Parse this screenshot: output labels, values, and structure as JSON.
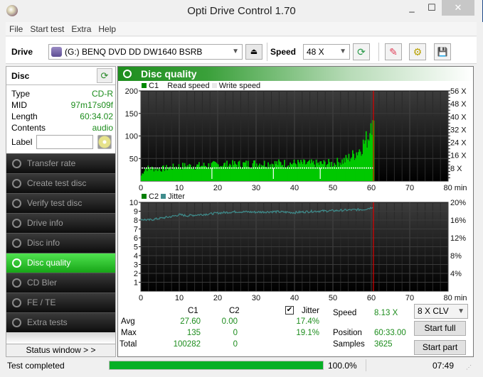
{
  "window": {
    "title": "Opti Drive Control 1.70",
    "min_label": "_",
    "max_label": "☐",
    "close_label": "✕"
  },
  "menu": [
    "File",
    "Start test",
    "Extra",
    "Help"
  ],
  "toolbar": {
    "drive_label": "Drive",
    "drive_value": "(G:)  BENQ DVD DD DW1640 BSRB",
    "eject_icon": "⏏",
    "speed_label": "Speed",
    "speed_value": "48 X",
    "refresh_icon": "⟳",
    "erase_icon": "✎",
    "settings_icon": "⚙",
    "save_icon": "💾"
  },
  "disc": {
    "title": "Disc",
    "refresh_icon": "⟳",
    "rows": [
      {
        "key": "Type",
        "value": "CD-R"
      },
      {
        "key": "MID",
        "value": "97m17s09f"
      },
      {
        "key": "Length",
        "value": "60:34.02"
      },
      {
        "key": "Contents",
        "value": "audio"
      }
    ],
    "label_key": "Label",
    "label_value": ""
  },
  "nav": [
    {
      "label": "Transfer rate",
      "active": false
    },
    {
      "label": "Create test disc",
      "active": false
    },
    {
      "label": "Verify test disc",
      "active": false
    },
    {
      "label": "Drive info",
      "active": false
    },
    {
      "label": "Disc info",
      "active": false
    },
    {
      "label": "Disc quality",
      "active": true
    },
    {
      "label": "CD Bler",
      "active": false
    },
    {
      "label": "FE / TE",
      "active": false
    },
    {
      "label": "Extra tests",
      "active": false
    }
  ],
  "status_window_label": "Status window > >",
  "main": {
    "title": "Disc quality"
  },
  "colors": {
    "c1": "#00c800",
    "c2": "#007f00",
    "jitter": "#3f8c8c",
    "read_speed": "#ffffff",
    "position_marker": "#e00000",
    "accent": "#1e8e1e"
  },
  "chart_data": [
    {
      "type": "bar",
      "title": "C1",
      "legend": [
        "C1",
        "Read speed",
        "Write speed"
      ],
      "xlabel": "min",
      "x_ticks": [
        "0",
        "10",
        "20",
        "30",
        "40",
        "50",
        "60",
        "70",
        "80 min"
      ],
      "xlim": [
        0,
        80
      ],
      "ylim": [
        0,
        200
      ],
      "y_ticks": [
        "50",
        "100",
        "150",
        "200"
      ],
      "y2_ticks": [
        "8 X",
        "16 X",
        "24 X",
        "32 X",
        "40 X",
        "48 X",
        "56 X"
      ],
      "y2lim": [
        0,
        56
      ],
      "position_marker": 60.55,
      "series": [
        {
          "name": "C1",
          "profile": [
            [
              0,
              12
            ],
            [
              1,
              28
            ],
            [
              5,
              26
            ],
            [
              10,
              32
            ],
            [
              15,
              33
            ],
            [
              20,
              35
            ],
            [
              25,
              36
            ],
            [
              30,
              38
            ],
            [
              35,
              38
            ],
            [
              40,
              38
            ],
            [
              45,
              37
            ],
            [
              50,
              38
            ],
            [
              53,
              45
            ],
            [
              55,
              55
            ],
            [
              57,
              70
            ],
            [
              59,
              95
            ],
            [
              60,
              125
            ],
            [
              60.5,
              110
            ]
          ],
          "max": 135
        },
        {
          "name": "Read speed",
          "constant": 8.1,
          "dips_at": [
            18.5,
            34.5,
            46.7
          ]
        }
      ]
    },
    {
      "type": "line",
      "title": "C2 / Jitter",
      "legend": [
        "C2",
        "Jitter"
      ],
      "xlabel": "min",
      "x_ticks": [
        "0",
        "10",
        "20",
        "30",
        "40",
        "50",
        "60",
        "70",
        "80 min"
      ],
      "xlim": [
        0,
        80
      ],
      "ylim": [
        0,
        10
      ],
      "y_ticks": [
        "1",
        "2",
        "3",
        "4",
        "5",
        "6",
        "7",
        "8",
        "9",
        "10"
      ],
      "y2_ticks": [
        "4%",
        "8%",
        "12%",
        "16%",
        "20%"
      ],
      "y2lim": [
        0,
        20
      ],
      "position_marker": 60.55,
      "series": [
        {
          "name": "C2",
          "values_constant": 0
        },
        {
          "name": "Jitter",
          "points": [
            [
              0,
              16.2
            ],
            [
              2,
              16.0
            ],
            [
              5,
              16.4
            ],
            [
              8,
              16.8
            ],
            [
              10,
              17.2
            ],
            [
              12,
              17.0
            ],
            [
              15,
              17.2
            ],
            [
              18,
              17.4
            ],
            [
              20,
              17.6
            ],
            [
              25,
              17.9
            ],
            [
              30,
              17.8
            ],
            [
              35,
              17.9
            ],
            [
              40,
              17.7
            ],
            [
              45,
              18.0
            ],
            [
              50,
              18.1
            ],
            [
              55,
              18.3
            ],
            [
              58,
              18.4
            ],
            [
              60,
              18.8
            ],
            [
              60.5,
              19.1
            ]
          ]
        }
      ]
    }
  ],
  "stats": {
    "col_c1": "C1",
    "col_c2": "C2",
    "col_jitter": "Jitter",
    "jitter_checked": true,
    "rows": [
      {
        "label": "Avg",
        "c1": "27.60",
        "c2": "0.00",
        "jitter": "17.4%"
      },
      {
        "label": "Max",
        "c1": "135",
        "c2": "0",
        "jitter": "19.1%"
      },
      {
        "label": "Total",
        "c1": "100282",
        "c2": "0",
        "jitter": ""
      }
    ],
    "speed_label": "Speed",
    "speed_value": "8.13 X",
    "position_label": "Position",
    "position_value": "60:33.00",
    "samples_label": "Samples",
    "samples_value": "3625",
    "mode_value": "8 X CLV",
    "start_full_label": "Start full",
    "start_part_label": "Start part"
  },
  "statusbar": {
    "text": "Test completed",
    "progress": 100.0,
    "progress_label": "100.0%",
    "time": "07:49"
  }
}
